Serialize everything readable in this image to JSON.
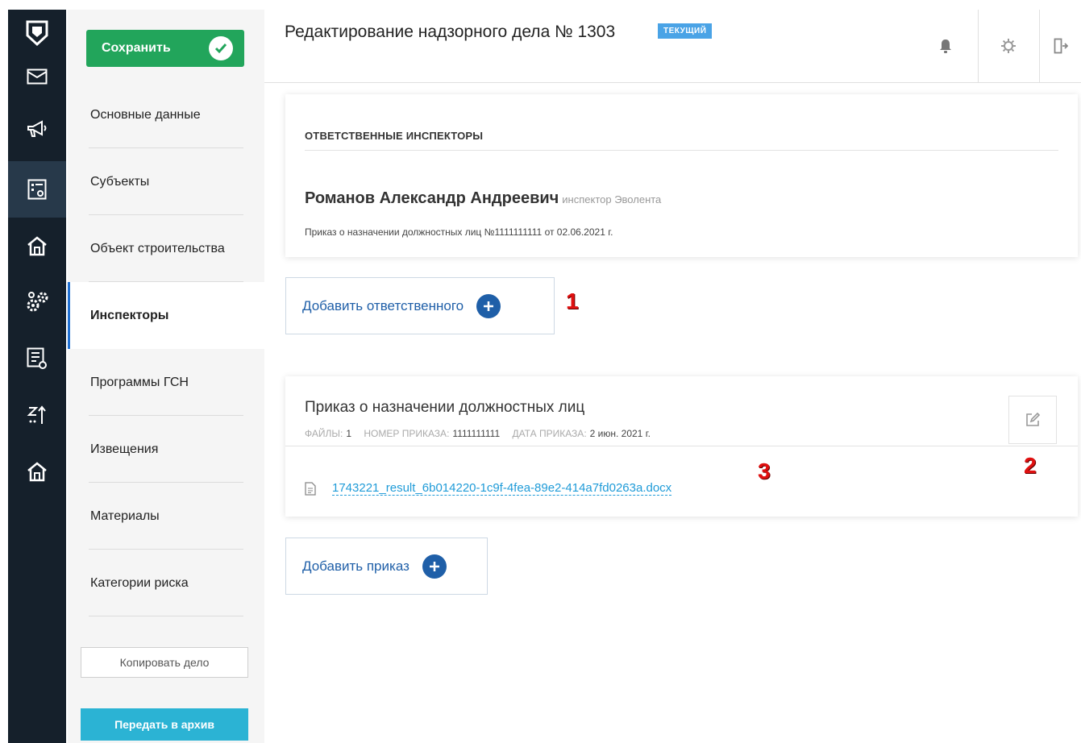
{
  "rail": {
    "icons": [
      "shield-logo-icon",
      "mail-icon",
      "megaphone-icon",
      "form-list-icon",
      "home-icon",
      "gears-icon",
      "report-icon",
      "sort-icon",
      "home-icon"
    ]
  },
  "nav": {
    "save_label": "Сохранить",
    "items": [
      {
        "label": "Основные данные"
      },
      {
        "label": "Субъекты"
      },
      {
        "label": "Объект строительства"
      },
      {
        "label": "Инспекторы"
      },
      {
        "label": "Программы ГСН"
      },
      {
        "label": "Извещения"
      },
      {
        "label": "Материалы"
      },
      {
        "label": "Категории риска"
      }
    ],
    "active_item": "Инспекторы",
    "copy_label": "Копировать дело",
    "archive_label": "Передать в архив"
  },
  "header": {
    "title": "Редактирование надзорного дела № 1303",
    "badge": "ТЕКУЩИЙ",
    "icons": [
      "bell-icon",
      "gear-icon",
      "logout-icon"
    ]
  },
  "inspectors": {
    "caption": "ОТВЕТСТВЕННЫЕ ИНСПЕКТОРЫ",
    "name": "Романов Александр Андреевич",
    "role": "инспектор Эволента",
    "order_line": "Приказ о назначении должностных лиц №1111111111 от 02.06.2021 г.",
    "add_label": "Добавить ответственного"
  },
  "order": {
    "title": "Приказ о назначении должностных лиц",
    "files_key": "ФАЙЛЫ:",
    "files_val": "1",
    "number_key": "НОМЕР ПРИКАЗА:",
    "number_val": "1111111111",
    "date_key": "ДАТА ПРИКАЗА:",
    "date_val": "2 июн. 2021 г.",
    "file_name": "1743221_result_6b014220-1c9f-4fea-89e2-414a7fd0263a.docx",
    "add_label": "Добавить приказ"
  },
  "markers": {
    "m1": "1",
    "m2": "2",
    "m3": "3"
  },
  "colors": {
    "rail": "#15202b",
    "save": "#22a55b",
    "accent": "#1f5fa8",
    "link": "#1f9bd8",
    "archive": "#2bb3d4",
    "badge": "#4aa3e6",
    "marker": "#e01010"
  }
}
